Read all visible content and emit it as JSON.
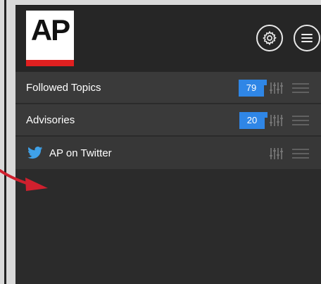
{
  "logo": {
    "text": "AP",
    "bar_color": "#e02020"
  },
  "header": {
    "settings_icon": "gear-icon",
    "menu_icon": "hamburger-menu-icon"
  },
  "rows": [
    {
      "label": "Followed Topics",
      "count": "79",
      "icon": "filter-sliders-icon"
    },
    {
      "label": "Advisories",
      "count": "20",
      "icon": "filter-sliders-icon"
    },
    {
      "label": "AP on Twitter",
      "prefix_icon": "twitter-bird-icon",
      "icon": "filter-sliders-icon"
    }
  ],
  "colors": {
    "accent": "#2f86e6",
    "annotation_arrow": "#d0202e",
    "panel_background": "#2b2b2b"
  }
}
